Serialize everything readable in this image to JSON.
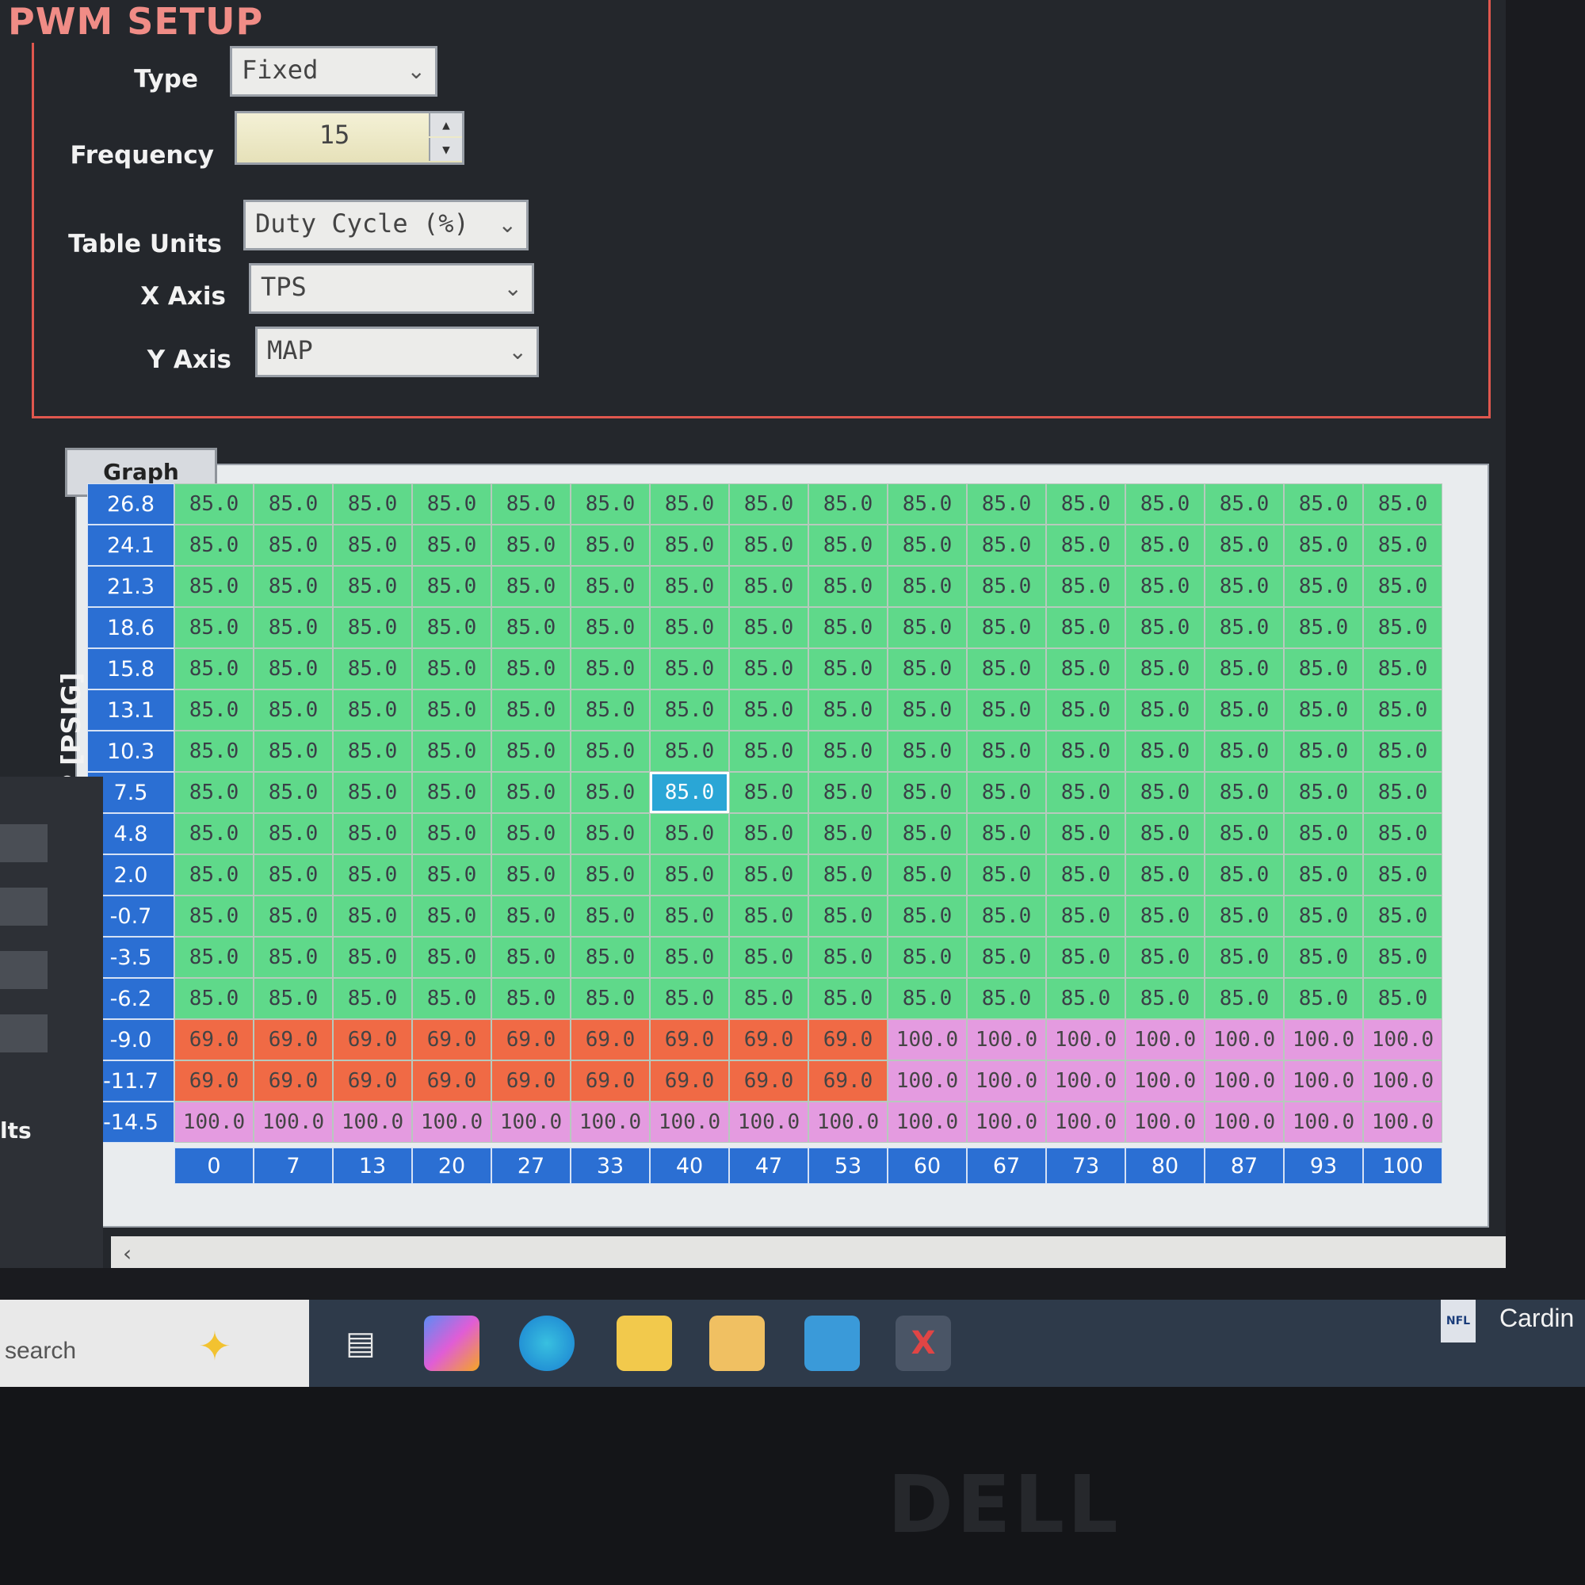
{
  "setup": {
    "title": "PWM SETUP",
    "type_label": "Type",
    "type_value": "Fixed",
    "frequency_label": "Frequency",
    "frequency_value": "15",
    "table_units_label": "Table Units",
    "table_units_value": "Duty Cycle (%)",
    "x_axis_label": "X Axis",
    "x_axis_value": "TPS",
    "y_axis_label": "Y Axis",
    "y_axis_value": "MAP"
  },
  "graph_button": "Graph",
  "table": {
    "y_axis_title": "MAP [PSIG]",
    "y_values": [
      "26.8",
      "24.1",
      "21.3",
      "18.6",
      "15.8",
      "13.1",
      "10.3",
      "7.5",
      "4.8",
      "2.0",
      "-0.7",
      "-3.5",
      "-6.2",
      "-9.0",
      "-11.7",
      "-14.5"
    ],
    "x_values": [
      "0",
      "7",
      "13",
      "20",
      "27",
      "33",
      "40",
      "47",
      "53",
      "60",
      "67",
      "73",
      "80",
      "87",
      "93",
      "100"
    ],
    "rows": [
      [
        "85.0",
        "85.0",
        "85.0",
        "85.0",
        "85.0",
        "85.0",
        "85.0",
        "85.0",
        "85.0",
        "85.0",
        "85.0",
        "85.0",
        "85.0",
        "85.0",
        "85.0",
        "85.0"
      ],
      [
        "85.0",
        "85.0",
        "85.0",
        "85.0",
        "85.0",
        "85.0",
        "85.0",
        "85.0",
        "85.0",
        "85.0",
        "85.0",
        "85.0",
        "85.0",
        "85.0",
        "85.0",
        "85.0"
      ],
      [
        "85.0",
        "85.0",
        "85.0",
        "85.0",
        "85.0",
        "85.0",
        "85.0",
        "85.0",
        "85.0",
        "85.0",
        "85.0",
        "85.0",
        "85.0",
        "85.0",
        "85.0",
        "85.0"
      ],
      [
        "85.0",
        "85.0",
        "85.0",
        "85.0",
        "85.0",
        "85.0",
        "85.0",
        "85.0",
        "85.0",
        "85.0",
        "85.0",
        "85.0",
        "85.0",
        "85.0",
        "85.0",
        "85.0"
      ],
      [
        "85.0",
        "85.0",
        "85.0",
        "85.0",
        "85.0",
        "85.0",
        "85.0",
        "85.0",
        "85.0",
        "85.0",
        "85.0",
        "85.0",
        "85.0",
        "85.0",
        "85.0",
        "85.0"
      ],
      [
        "85.0",
        "85.0",
        "85.0",
        "85.0",
        "85.0",
        "85.0",
        "85.0",
        "85.0",
        "85.0",
        "85.0",
        "85.0",
        "85.0",
        "85.0",
        "85.0",
        "85.0",
        "85.0"
      ],
      [
        "85.0",
        "85.0",
        "85.0",
        "85.0",
        "85.0",
        "85.0",
        "85.0",
        "85.0",
        "85.0",
        "85.0",
        "85.0",
        "85.0",
        "85.0",
        "85.0",
        "85.0",
        "85.0"
      ],
      [
        "85.0",
        "85.0",
        "85.0",
        "85.0",
        "85.0",
        "85.0",
        "85.0",
        "85.0",
        "85.0",
        "85.0",
        "85.0",
        "85.0",
        "85.0",
        "85.0",
        "85.0",
        "85.0"
      ],
      [
        "85.0",
        "85.0",
        "85.0",
        "85.0",
        "85.0",
        "85.0",
        "85.0",
        "85.0",
        "85.0",
        "85.0",
        "85.0",
        "85.0",
        "85.0",
        "85.0",
        "85.0",
        "85.0"
      ],
      [
        "85.0",
        "85.0",
        "85.0",
        "85.0",
        "85.0",
        "85.0",
        "85.0",
        "85.0",
        "85.0",
        "85.0",
        "85.0",
        "85.0",
        "85.0",
        "85.0",
        "85.0",
        "85.0"
      ],
      [
        "85.0",
        "85.0",
        "85.0",
        "85.0",
        "85.0",
        "85.0",
        "85.0",
        "85.0",
        "85.0",
        "85.0",
        "85.0",
        "85.0",
        "85.0",
        "85.0",
        "85.0",
        "85.0"
      ],
      [
        "85.0",
        "85.0",
        "85.0",
        "85.0",
        "85.0",
        "85.0",
        "85.0",
        "85.0",
        "85.0",
        "85.0",
        "85.0",
        "85.0",
        "85.0",
        "85.0",
        "85.0",
        "85.0"
      ],
      [
        "85.0",
        "85.0",
        "85.0",
        "85.0",
        "85.0",
        "85.0",
        "85.0",
        "85.0",
        "85.0",
        "85.0",
        "85.0",
        "85.0",
        "85.0",
        "85.0",
        "85.0",
        "85.0"
      ],
      [
        "69.0",
        "69.0",
        "69.0",
        "69.0",
        "69.0",
        "69.0",
        "69.0",
        "69.0",
        "69.0",
        "100.0",
        "100.0",
        "100.0",
        "100.0",
        "100.0",
        "100.0",
        "100.0"
      ],
      [
        "69.0",
        "69.0",
        "69.0",
        "69.0",
        "69.0",
        "69.0",
        "69.0",
        "69.0",
        "69.0",
        "100.0",
        "100.0",
        "100.0",
        "100.0",
        "100.0",
        "100.0",
        "100.0"
      ],
      [
        "100.0",
        "100.0",
        "100.0",
        "100.0",
        "100.0",
        "100.0",
        "100.0",
        "100.0",
        "100.0",
        "100.0",
        "100.0",
        "100.0",
        "100.0",
        "100.0",
        "100.0",
        "100.0"
      ]
    ],
    "selected_row": 7,
    "selected_col": 6
  },
  "sidebar": {
    "partial_label": "lts"
  },
  "taskbar": {
    "search_label": "search",
    "icons": [
      "task-view-icon",
      "copilot-icon",
      "edge-icon",
      "file-explorer-icon",
      "store-icon",
      "outlook-icon",
      "x3-app-icon"
    ],
    "news_text": "Cardin"
  },
  "bezel": {
    "brand": "DELL"
  },
  "colors": {
    "cell_85": "#5fd98a",
    "cell_69": "#f06a45",
    "cell_100": "#e49be0",
    "axis_blue": "#2b6fd3",
    "panel_border": "#e0574e"
  }
}
